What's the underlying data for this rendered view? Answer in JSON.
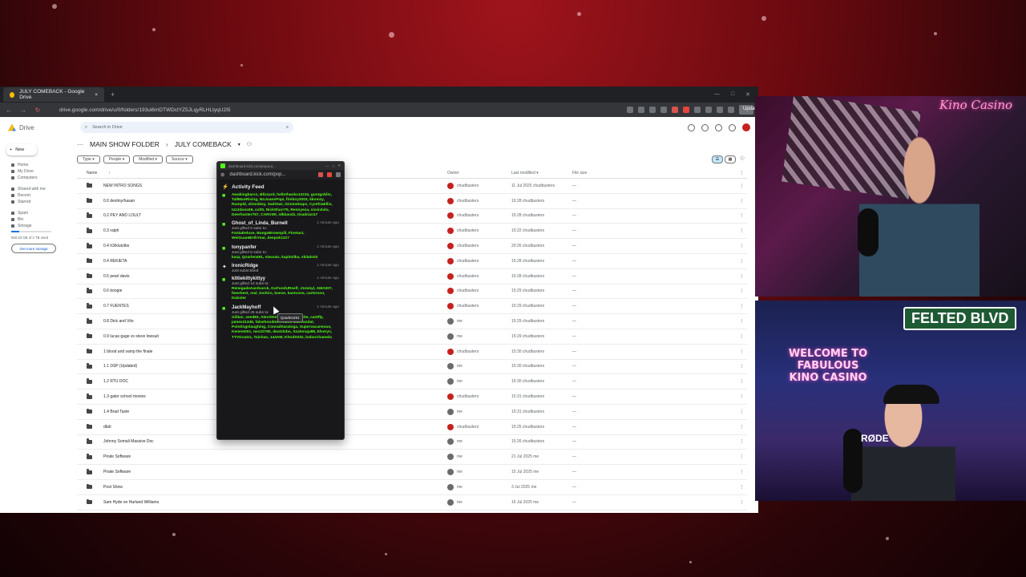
{
  "browser": {
    "tab_title": "JULY COMEBACK - Google Drive",
    "tab_close": "×",
    "new_tab": "+",
    "url": "drive.google.com/drive/u/0/folders/193ui6mDTWDctYZ5JLqyRLHLtyqU2I5",
    "update_label": "Update"
  },
  "drive": {
    "app_name": "Drive",
    "search_placeholder": "Search in Drive",
    "new_label": "New",
    "sidebar": [
      {
        "label": "Home"
      },
      {
        "label": "My Drive"
      },
      {
        "label": "Computers"
      },
      {
        "label": "Shared with me"
      },
      {
        "label": "Recent"
      },
      {
        "label": "Starred"
      },
      {
        "label": "Spam"
      },
      {
        "label": "Bin"
      },
      {
        "label": "Storage"
      }
    ],
    "storage_text": "550.53 GB of 2 TB used",
    "get_storage": "Get more storage",
    "breadcrumbs": [
      "MAIN SHOW FOLDER",
      "JULY COMEBACK"
    ],
    "filters": [
      "Type",
      "People",
      "Modified",
      "Source"
    ],
    "columns": {
      "name": "Name",
      "owner": "Owner",
      "modified": "Last modified",
      "size": "File size"
    },
    "rows": [
      {
        "name": "NEW INTRO SONGS",
        "owner": "chudbusters",
        "modified": "11 Jul 2025 chudbusters",
        "size": "—",
        "me": false
      },
      {
        "name": "0.0 destiny/hasan",
        "owner": "chudbusters",
        "modified": "15:28 chudbusters",
        "size": "—",
        "me": false
      },
      {
        "name": "0.2 PEY AND LOULT",
        "owner": "chudbusters",
        "modified": "15:28 chudbusters",
        "size": "—",
        "me": false
      },
      {
        "name": "0.3 ralph",
        "owner": "chudbusters",
        "modified": "15:22 chudbusters",
        "size": "—",
        "me": false
      },
      {
        "name": "0.4 h3/klutztbs",
        "owner": "chudbusters",
        "modified": "20:26 chudbusters",
        "size": "—",
        "me": false
      },
      {
        "name": "0.4 REKIETA",
        "owner": "chudbusters",
        "modified": "15:28 chudbusters",
        "size": "—",
        "me": false
      },
      {
        "name": "0.5 pearl davis",
        "owner": "chudbusters",
        "modified": "15:28 chudbusters",
        "size": "—",
        "me": false
      },
      {
        "name": "0.6 boogie",
        "owner": "chudbusters",
        "modified": "15:29 chudbusters",
        "size": "—",
        "me": false
      },
      {
        "name": "0.7 FUENTES",
        "owner": "chudbusters",
        "modified": "15:29 chudbusters",
        "size": "—",
        "me": false
      },
      {
        "name": "0.8 Dick and Vito",
        "owner": "me",
        "modified": "15:29 chudbusters",
        "size": "—",
        "me": true
      },
      {
        "name": "0.9 lucas gage vs steve lowsuit",
        "owner": "me",
        "modified": "15:29 chudbusters",
        "size": "—",
        "me": true
      },
      {
        "name": "1 blood and vamp the finale",
        "owner": "chudbusters",
        "modified": "15:30 chudbusters",
        "size": "—",
        "me": false
      },
      {
        "name": "1.1 DSP (Updated)",
        "owner": "me",
        "modified": "15:30 chudbusters",
        "size": "—",
        "me": true
      },
      {
        "name": "1.2 RTU DOC",
        "owner": "me",
        "modified": "15:30 chudbusters",
        "size": "—",
        "me": true
      },
      {
        "name": "1.3 gator school movies",
        "owner": "chudbusters",
        "modified": "15:31 chudbusters",
        "size": "—",
        "me": false
      },
      {
        "name": "1.4 Brad Taste",
        "owner": "me",
        "modified": "15:31 chudbusters",
        "size": "—",
        "me": true
      },
      {
        "name": "dbdr",
        "owner": "chudbusters",
        "modified": "15:25 chudbusters",
        "size": "—",
        "me": false
      },
      {
        "name": "Johnny Somali Massive Doc",
        "owner": "me",
        "modified": "15:26 chudbusters",
        "size": "—",
        "me": true
      },
      {
        "name": "Pirate Software",
        "owner": "me",
        "modified": "21 Jul 2025 me",
        "size": "—",
        "me": true
      },
      {
        "name": "Pirate Software",
        "owner": "me",
        "modified": "15 Jul 2025 me",
        "size": "—",
        "me": true
      },
      {
        "name": "Post Show",
        "owner": "me",
        "modified": "3 Jul 2025 me",
        "size": "—",
        "me": true
      },
      {
        "name": "Sam Hyde on Harland Williams",
        "owner": "me",
        "modified": "16 Jul 2025 me",
        "size": "—",
        "me": true
      },
      {
        "name": "TILTON",
        "owner": "chudbusters",
        "modified": "18:09 chudbusters",
        "size": "—",
        "me": false
      }
    ]
  },
  "popup": {
    "window_title": "dashboard.kick.com/popout...",
    "url": "dashboard.kick.com/pop...",
    "title": "Activity Feed",
    "items": [
      {
        "user": "",
        "time": "",
        "sub": "",
        "names": "Awakingbars1, Blizzard, hellothanks12234, guntgoblin, TallManRising, NoJuansPapi, fireboy2003, kkomzy, Rumpld, slimnikey, SadiGwi, GimmeDaps, CynthiaEllis, ta13dunc69, xxlt0, NickSharr75, Rennyssa, sixsixlulu, Deerhunter757, CARV3R, idkbandz, Itsadrian17",
        "icon": "gift"
      },
      {
        "user": "Ghost_of_Linda_Burnell",
        "time": "1 minute ago",
        "sub": "Just gifted 5 subs to:",
        "names": "FantaDeluxe, BungoBrownpill, Finetact, WeiGuanBirthYear, deepok1227",
        "icon": "gift"
      },
      {
        "user": "tonypanfer",
        "time": "1 minute ago",
        "sub": "Just gifted 5 subs to:",
        "names": "karp, Qoarlen491, vieux4o, kapitolika, skitals03",
        "icon": "gift"
      },
      {
        "user": "IronicRidge",
        "time": "1 minute ago",
        "sub": "Just subscribed",
        "names": "",
        "icon": "star"
      },
      {
        "user": "kittiekittykittyy",
        "time": "1 minute ago",
        "sub": "Just gifted 10 subs to:",
        "names": "RenegadeAardvarck, GoFundURself, J1mmyl, AMA007, fweshest, real_toshiro, koexe, kaotcone, carterson, Dubster",
        "icon": "gift"
      },
      {
        "user": "JackMayhoff",
        "time": "1 minute ago",
        "sub": "Just gifted 25 subs to:",
        "names": "Gillian_seed83, AlexSteinsDaddy, DasRite, cantfly, james21346, falsehoodmerchant, MadVandal, Pointingnlaughing, ConradSaratoga, Supervacaneous, Kenem001, rwo22780, deutzlobo, Szalonaja88, Elveryn, TTVGoatzz, Taishan, 144AM, KhodS032, boborchamela",
        "icon": "gift"
      }
    ],
    "tooltip": "Qoarlen491"
  },
  "stream": {
    "brand": "Kino Casino",
    "street_sign": "FELTED BLVD",
    "neon_sign": "WELCOME TO FABULOUS KINO CASINO",
    "mic_brand": "RØDE"
  },
  "colors": {
    "kick_green": "#53fc18",
    "drive_blue": "#0b57d0",
    "stream_red": "#8b0f16"
  }
}
